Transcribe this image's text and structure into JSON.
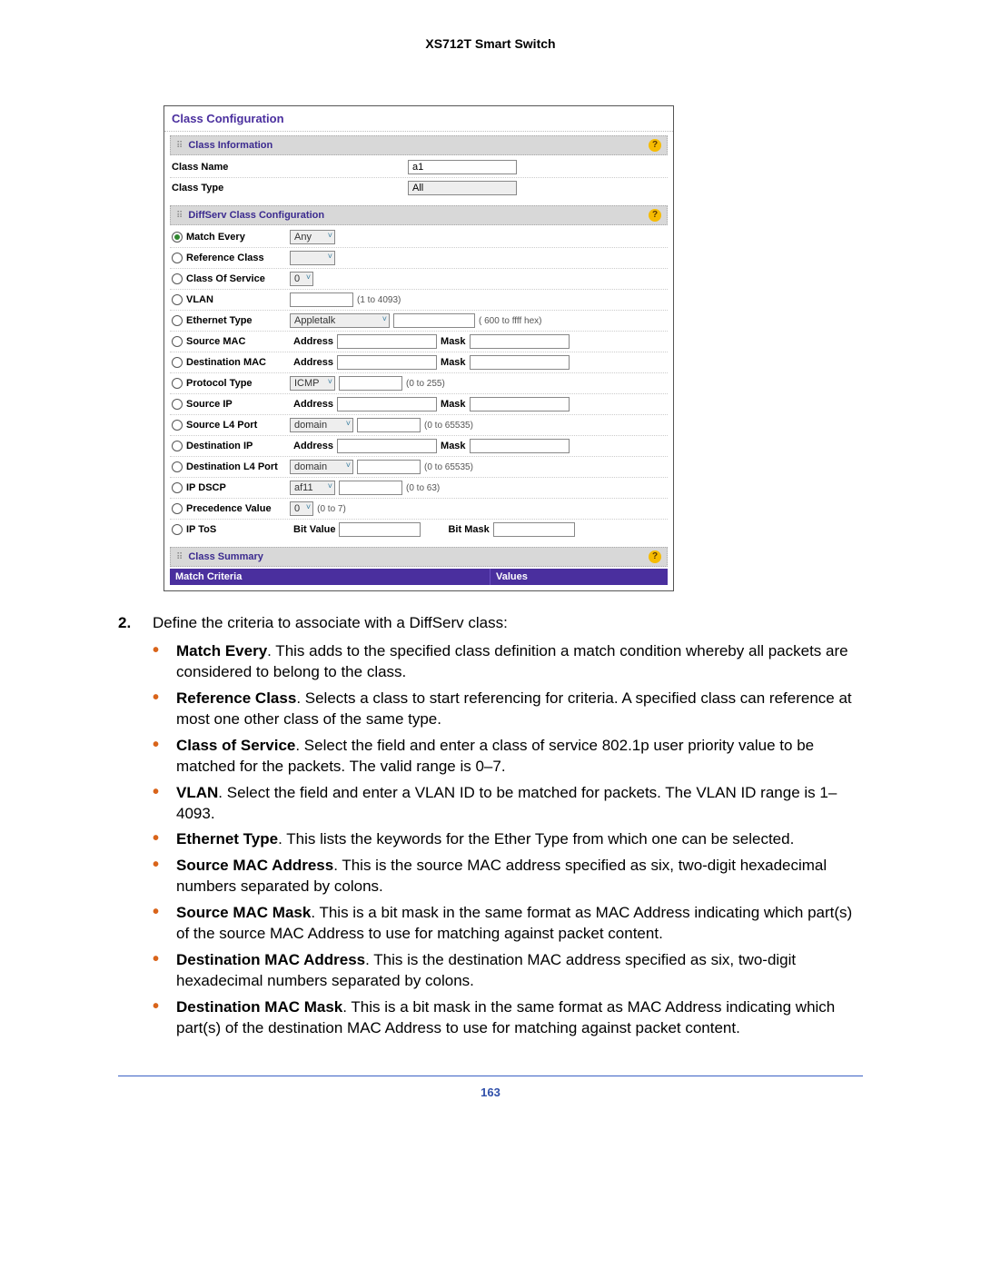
{
  "doc": {
    "title": "XS712T Smart Switch",
    "page_number": "163",
    "step_number": "2.",
    "step_text": "Define the criteria to associate with a DiffServ class:"
  },
  "shot": {
    "title": "Class Configuration",
    "info": {
      "bar": "Class Information",
      "name_label": "Class Name",
      "name_value": "a1",
      "type_label": "Class Type",
      "type_value": "All"
    },
    "cfg": {
      "bar": "DiffServ Class Configuration",
      "rows": {
        "match_every": {
          "label": "Match Every",
          "select": "Any"
        },
        "reference_class": {
          "label": "Reference Class"
        },
        "class_of_service": {
          "label": "Class Of Service",
          "select": "0"
        },
        "vlan": {
          "label": "VLAN",
          "hint": "(1 to 4093)"
        },
        "ethernet_type": {
          "label": "Ethernet Type",
          "select": "Appletalk",
          "hint": "( 600 to ffff hex)"
        },
        "source_mac": {
          "label": "Source MAC",
          "sub1": "Address",
          "sub2": "Mask"
        },
        "dest_mac": {
          "label": "Destination MAC",
          "sub1": "Address",
          "sub2": "Mask"
        },
        "protocol_type": {
          "label": "Protocol Type",
          "select": "ICMP",
          "hint": "(0 to 255)"
        },
        "source_ip": {
          "label": "Source IP",
          "sub1": "Address",
          "sub2": "Mask"
        },
        "source_l4": {
          "label": "Source L4 Port",
          "select": "domain",
          "hint": "(0 to 65535)"
        },
        "dest_ip": {
          "label": "Destination IP",
          "sub1": "Address",
          "sub2": "Mask"
        },
        "dest_l4": {
          "label": "Destination L4 Port",
          "select": "domain",
          "hint": "(0 to 65535)"
        },
        "ip_dscp": {
          "label": "IP DSCP",
          "select": "af11",
          "hint": "(0 to 63)"
        },
        "precedence": {
          "label": "Precedence Value",
          "select": "0",
          "hint": "(0 to 7)"
        },
        "ip_tos": {
          "label": "IP ToS",
          "sub1": "Bit Value",
          "sub2": "Bit Mask"
        }
      }
    },
    "summary": {
      "bar": "Class Summary",
      "col1": "Match Criteria",
      "col2": "Values"
    }
  },
  "bullets": {
    "me": {
      "term": "Match Every",
      "text": ". This adds to the specified class definition a match condition whereby all packets are considered to belong to the class."
    },
    "rc": {
      "term": "Reference Class",
      "text": ". Selects a class to start referencing for criteria. A specified class can reference at most one other class of the same type."
    },
    "cos": {
      "term": "Class of Service",
      "text": ". Select the field and enter a class of service 802.1p user priority value to be matched for the packets. The valid range is 0–7."
    },
    "vlan": {
      "term": "VLAN",
      "text": ". Select the field and enter a VLAN ID to be matched for packets. The VLAN ID range is 1–4093."
    },
    "et": {
      "term": "Ethernet Type",
      "text": ". This lists the keywords for the Ether Type from which one can be selected."
    },
    "sma": {
      "term": "Source MAC Address",
      "text": ". This is the source MAC address specified as six, two-digit hexadecimal numbers separated by colons."
    },
    "smm": {
      "term": "Source MAC Mask",
      "text": ". This is a bit mask in the same format as MAC Address indicating which part(s) of the source MAC Address to use for matching against packet content."
    },
    "dma": {
      "term": "Destination MAC Address",
      "text": ". This is the destination MAC address specified as six, two-digit hexadecimal numbers separated by colons."
    },
    "dmm": {
      "term": "Destination MAC Mask",
      "text": ". This is a bit mask in the same format as MAC Address indicating which part(s) of the destination MAC Address to use for matching against packet content."
    }
  }
}
